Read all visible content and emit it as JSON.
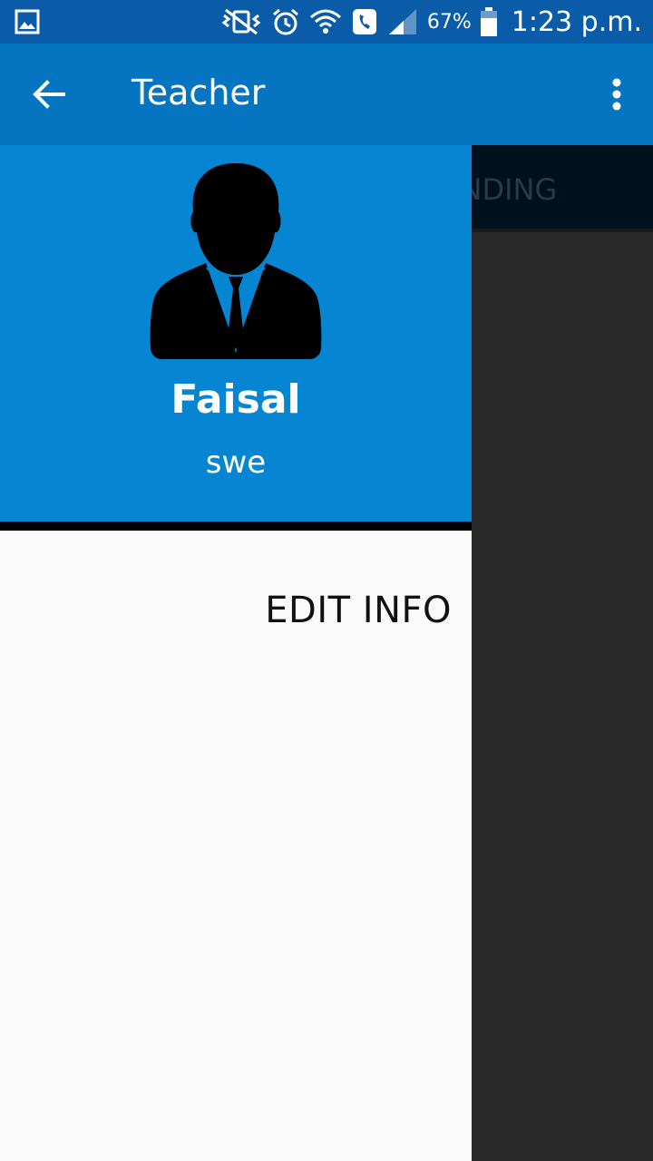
{
  "status_bar": {
    "battery_percent": "67%",
    "time": "1:23 p.m.",
    "icons": [
      "gallery-icon",
      "vibrate-off-icon",
      "alarm-icon",
      "wifi-icon",
      "phone-icon",
      "signal-icon",
      "battery-icon"
    ]
  },
  "app_bar": {
    "title": "Teacher",
    "back_icon": "arrow-left-icon",
    "menu_icon": "more-vert-icon",
    "color": "#0574C1"
  },
  "background": {
    "tab_partial": "PENDING"
  },
  "drawer": {
    "header_color": "#0585D2",
    "avatar_icon": "person-avatar-icon",
    "name": "Faisal",
    "subtitle": "swe",
    "menu_items": [
      {
        "label": "EDIT INFO"
      }
    ]
  }
}
